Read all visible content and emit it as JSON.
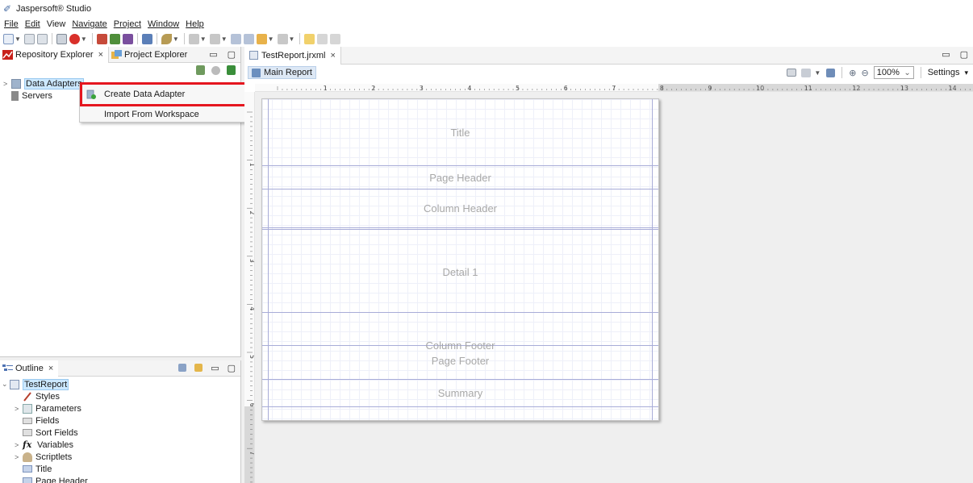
{
  "app": {
    "title": "Jaspersoft® Studio"
  },
  "menu": [
    "File",
    "Edit",
    "View",
    "Navigate",
    "Project",
    "Window",
    "Help"
  ],
  "left_panel": {
    "tabs": [
      {
        "label": "Repository Explorer",
        "close": "×"
      },
      {
        "label": "Project Explorer"
      }
    ],
    "window_controls": {
      "minimize": "▭",
      "maximize": "▢"
    },
    "tree": [
      {
        "label": "Data Adapters",
        "expander": ">",
        "icon": "data-adapter-icon"
      },
      {
        "label": "Servers",
        "icon": "server-icon"
      }
    ]
  },
  "context_menu": {
    "items": [
      {
        "label": "Create Data Adapter",
        "icon": "create-data-adapter-icon"
      },
      {
        "label": "Import From Workspace"
      }
    ]
  },
  "outline": {
    "tab": {
      "label": "Outline",
      "close": "×"
    },
    "window_controls": {
      "minimize": "▭",
      "maximize": "▢"
    },
    "root": {
      "label": "TestReport",
      "expander": "⌄"
    },
    "children": [
      {
        "label": "Styles",
        "expander": "",
        "icon": "styles-icon"
      },
      {
        "label": "Parameters",
        "expander": ">",
        "icon": "parameters-icon"
      },
      {
        "label": "Fields",
        "expander": "",
        "icon": "fields-icon"
      },
      {
        "label": "Sort Fields",
        "expander": "",
        "icon": "sort-fields-icon"
      },
      {
        "label": "Variables",
        "expander": ">",
        "icon": "variables-icon"
      },
      {
        "label": "Scriptlets",
        "expander": ">",
        "icon": "scriptlets-icon"
      },
      {
        "label": "Title",
        "expander": "",
        "icon": "band-icon"
      },
      {
        "label": "Page Header",
        "expander": "",
        "icon": "band-icon"
      }
    ]
  },
  "editor": {
    "tab": {
      "label": "TestReport.jrxml",
      "close": "×"
    },
    "window_controls": {
      "minimize": "▭",
      "maximize": "▢"
    },
    "main_report_label": "Main Report",
    "zoom": "100%",
    "zoom_chevron": "⌄",
    "settings_label": "Settings",
    "settings_caret": "▾",
    "ruler_h_numbers": [
      "1",
      "2",
      "3",
      "4",
      "5",
      "6",
      "7",
      "8",
      "9",
      "10",
      "11",
      "12",
      "13",
      "14"
    ],
    "ruler_v_numbers": [
      "1",
      "2",
      "3",
      "4",
      "5",
      "6",
      "7"
    ],
    "bands": [
      "Title",
      "Page Header",
      "Column Header",
      "Detail 1",
      "Column Footer",
      "Page Footer",
      "Summary"
    ]
  },
  "colors": {
    "highlight": "#e5161f",
    "selection": "#cce8ff",
    "band_line": "#a8acd8"
  }
}
